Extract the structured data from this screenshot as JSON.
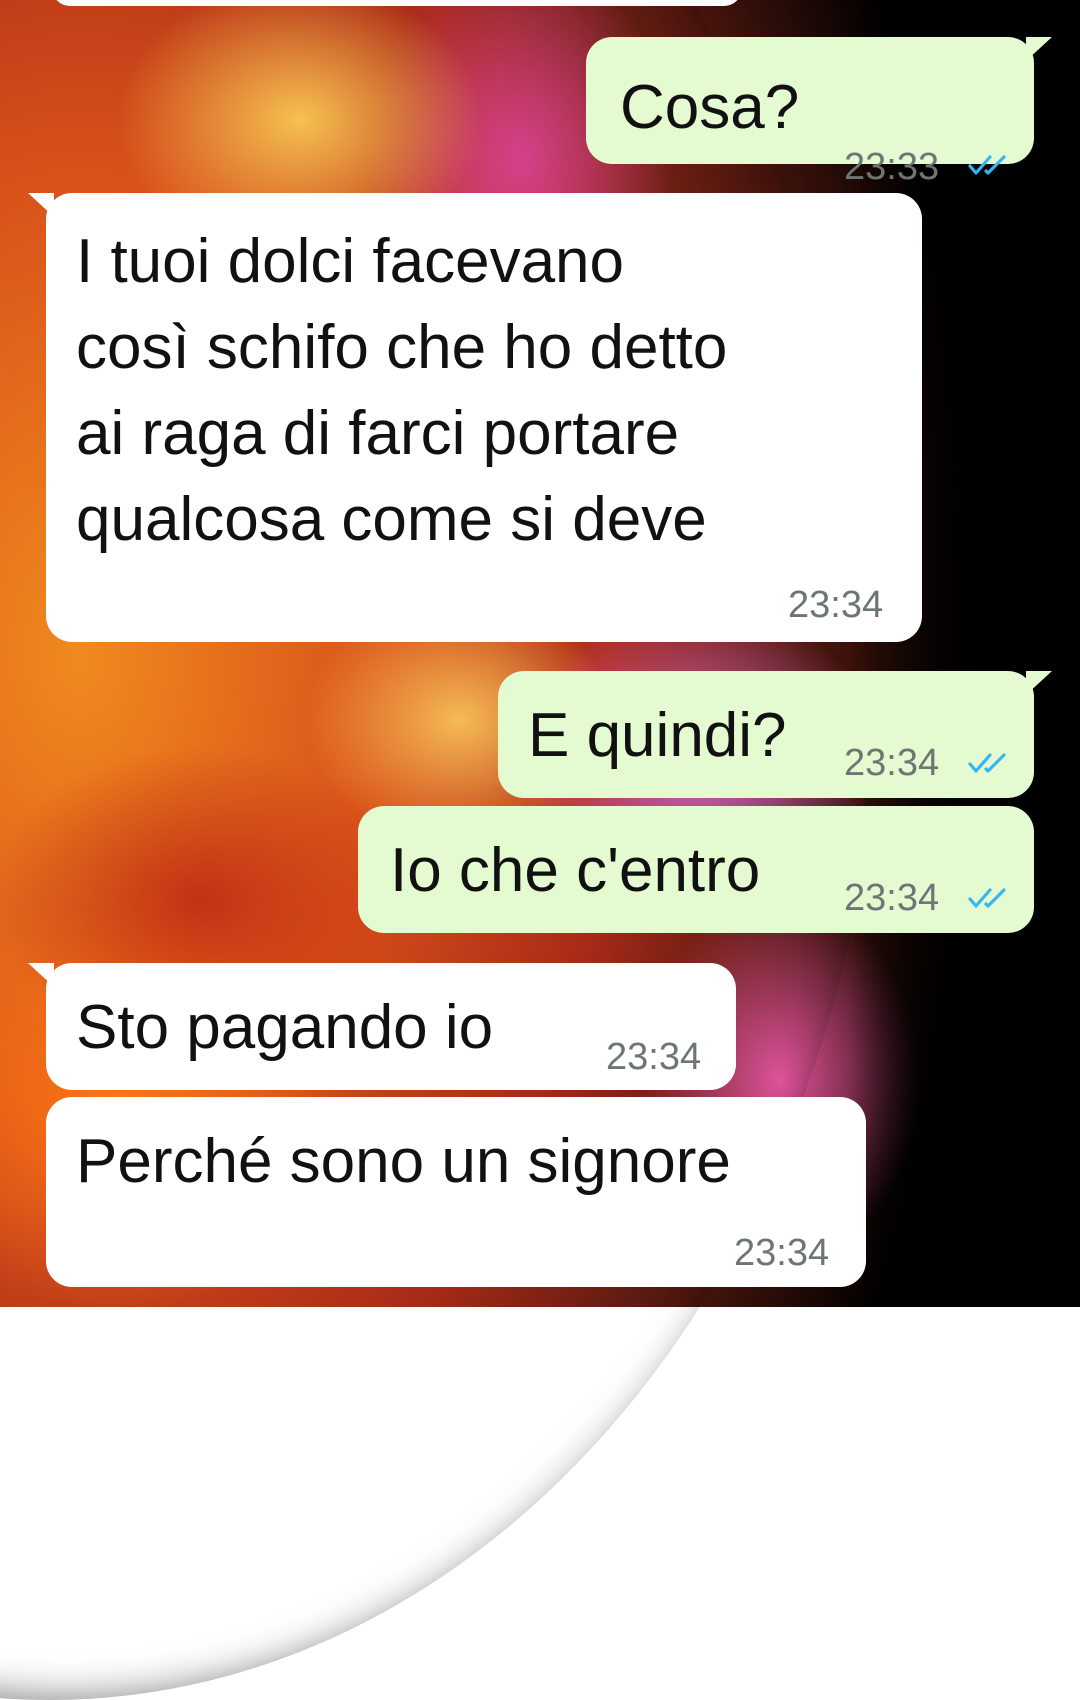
{
  "chat": {
    "messages": [
      {
        "direction": "out",
        "text": "Cosa?",
        "time": "23:33",
        "status": "read",
        "status_icon": "double-check-icon",
        "status_color": "#34b7f1"
      },
      {
        "direction": "in",
        "text": "I tuoi dolci facevano\ncosì schifo che ho detto\nai raga di farci portare\nqualcosa come si deve",
        "time": "23:34"
      },
      {
        "direction": "out",
        "text": "E quindi?",
        "time": "23:34",
        "status": "read",
        "status_icon": "double-check-icon",
        "status_color": "#34b7f1"
      },
      {
        "direction": "out",
        "text": "Io che c'entro",
        "time": "23:34",
        "status": "read",
        "status_icon": "double-check-icon",
        "status_color": "#34b7f1"
      },
      {
        "direction": "in",
        "text": "Sto pagando io",
        "time": "23:34"
      },
      {
        "direction": "in",
        "text": "Perché sono un signore",
        "time": "23:34"
      }
    ]
  },
  "colors": {
    "incoming_bubble": "#ffffff",
    "outgoing_bubble": "#e4fbd2",
    "timestamp": "#6e7675",
    "read_ticks": "#34b7f1"
  }
}
